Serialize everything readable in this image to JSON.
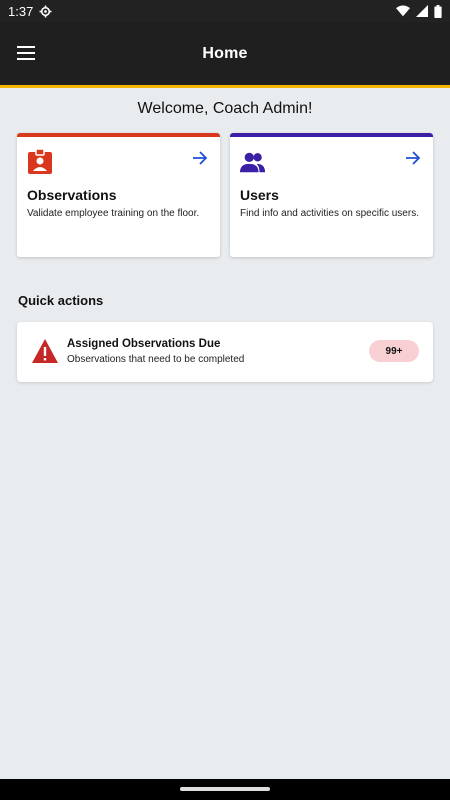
{
  "status_bar": {
    "time": "1:37",
    "icons": [
      "settings-gear-icon",
      "wifi-icon",
      "cellular-signal-icon",
      "battery-icon"
    ]
  },
  "app_bar": {
    "title": "Home",
    "menu_icon": "hamburger-menu-icon",
    "accent_color": "#f4b400"
  },
  "welcome": "Welcome, Coach Admin!",
  "cards": [
    {
      "title": "Observations",
      "description": "Validate employee training on the floor.",
      "icon": "badge-icon",
      "accent_color": "#d9381e"
    },
    {
      "title": "Users",
      "description": "Find info and activities on specific users.",
      "icon": "users-icon",
      "accent_color": "#3b1fa5"
    }
  ],
  "quick_actions": {
    "title": "Quick actions",
    "items": [
      {
        "title": "Assigned Observations Due",
        "subtitle": "Observations that need to be completed",
        "badge": "99+",
        "icon": "warning-icon"
      }
    ]
  }
}
